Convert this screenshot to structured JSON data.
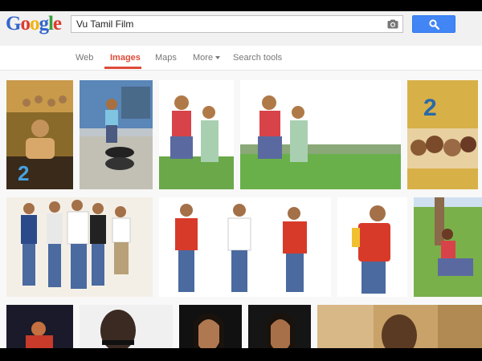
{
  "logo": {
    "letters": [
      "G",
      "o",
      "o",
      "g",
      "l",
      "e"
    ],
    "colors": [
      "#3366cc",
      "#dd3b2c",
      "#f2b40e",
      "#3366cc",
      "#3a9d3a",
      "#dd3b2c"
    ]
  },
  "search": {
    "value": "Vu Tamil Film"
  },
  "nav": {
    "web": "Web",
    "images": "Images",
    "maps": "Maps",
    "more": "More",
    "search_tools": "Search tools"
  },
  "colors": {
    "accent": "#dd4b39",
    "button": "#4285f4"
  },
  "results": [
    {
      "name": "poster-vu-film"
    },
    {
      "name": "boy-on-tire"
    },
    {
      "name": "boy-girl-field"
    },
    {
      "name": "boy-girl-field-wide"
    },
    {
      "name": "poster-group-faces"
    },
    {
      "name": "cast-group-white-bg"
    },
    {
      "name": "cast-group-red-vests"
    },
    {
      "name": "man-red-vest"
    },
    {
      "name": "man-sitting-field"
    },
    {
      "name": "dark-portrait-1"
    },
    {
      "name": "man-sunglasses"
    },
    {
      "name": "woman-portrait-1"
    },
    {
      "name": "woman-portrait-2"
    },
    {
      "name": "man-golden-bg"
    }
  ]
}
